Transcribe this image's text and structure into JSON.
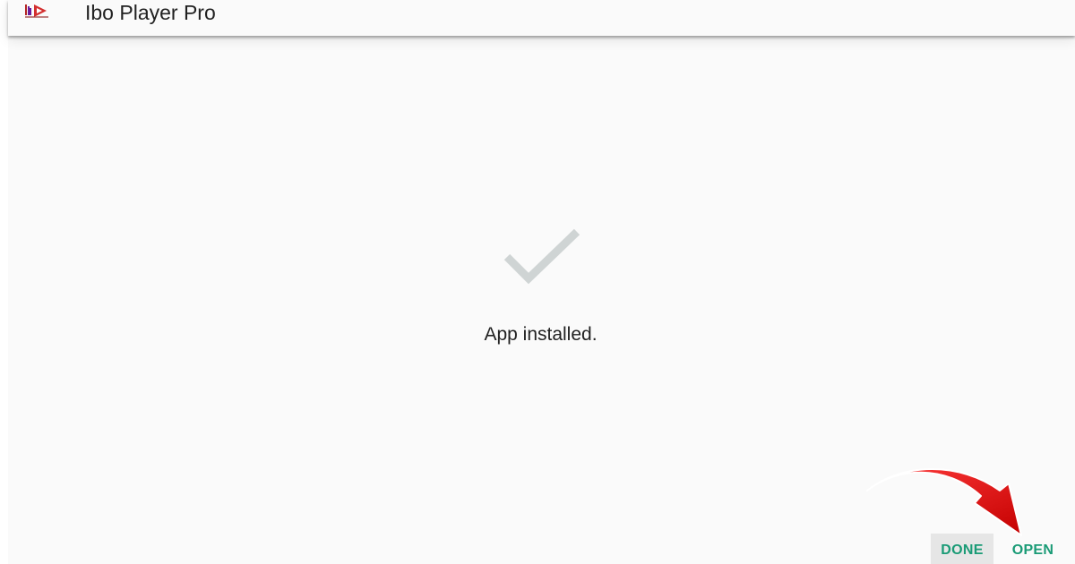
{
  "appbar": {
    "title": "Ibo Player Pro",
    "icon": "ibo-player-pro-logo-icon"
  },
  "main": {
    "status_icon": "checkmark-icon",
    "status_text": "App installed."
  },
  "actions": {
    "done_label": "DONE",
    "open_label": "OPEN"
  },
  "annotation": {
    "icon": "red-curved-arrow-icon"
  },
  "colors": {
    "accent": "#1a9b76",
    "check": "#cfd4d4",
    "arrow": "#e8151b",
    "background": "#fafafa"
  }
}
